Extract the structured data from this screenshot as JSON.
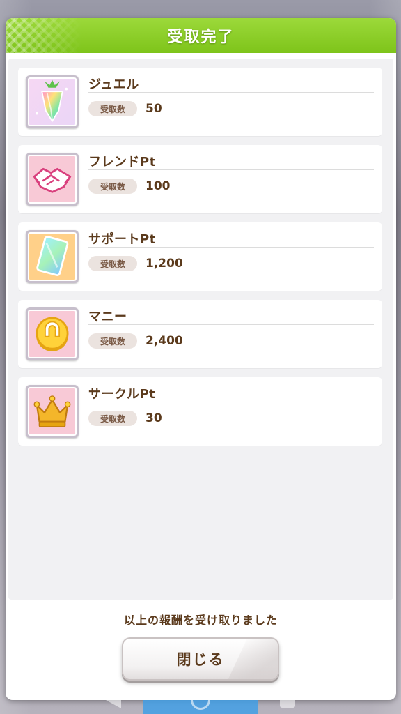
{
  "dialog": {
    "title": "受取完了",
    "header_color": "#8acd29",
    "footer_message": "以上の報酬を受け取りました",
    "close_button_label": "閉じる"
  },
  "rewards": [
    {
      "name": "ジュエル",
      "qty_label": "受取数",
      "qty": "50",
      "icon": "jewel-carrot-icon"
    },
    {
      "name": "フレンドPt",
      "qty_label": "受取数",
      "qty": "100",
      "icon": "handshake-icon"
    },
    {
      "name": "サポートPt",
      "qty_label": "受取数",
      "qty": "1,200",
      "icon": "support-card-icon"
    },
    {
      "name": "マニー",
      "qty_label": "受取数",
      "qty": "2,400",
      "icon": "horseshoe-coin-icon"
    },
    {
      "name": "サークルPt",
      "qty_label": "受取数",
      "qty": "30",
      "icon": "crown-icon"
    }
  ],
  "colors": {
    "text_brown": "#5b3a1c",
    "panel_bg": "#f1f1f3",
    "badge_bg": "#ebe3df"
  }
}
